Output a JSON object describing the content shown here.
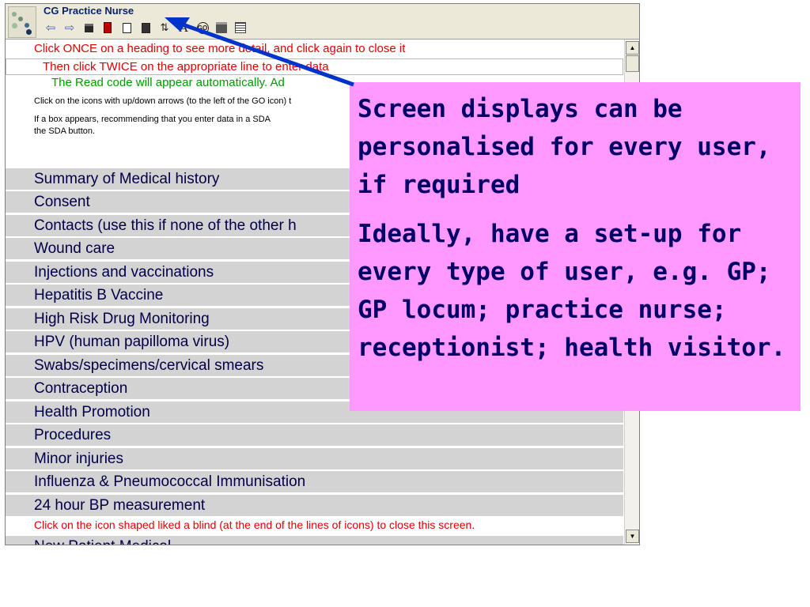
{
  "window": {
    "title": "CG Practice Nurse",
    "toolbar": [
      {
        "name": "back-arrow-icon",
        "glyph": "⇦"
      },
      {
        "name": "forward-arrow-icon",
        "glyph": "⇨"
      },
      {
        "name": "folder-icon",
        "glyph": ""
      },
      {
        "name": "book-icon",
        "glyph": ""
      },
      {
        "name": "document-icon",
        "glyph": ""
      },
      {
        "name": "notes-icon",
        "glyph": ""
      },
      {
        "name": "up-down-arrows-icon",
        "glyph": "⇅"
      },
      {
        "name": "font-icon",
        "glyph": "A"
      },
      {
        "name": "go-icon",
        "glyph": "GO"
      },
      {
        "name": "printer-icon",
        "glyph": ""
      },
      {
        "name": "blind-icon",
        "glyph": ""
      }
    ]
  },
  "instructions": {
    "line1": "Click ONCE on a heading to see more detail, and click again to close it",
    "line2": "Then click TWICE on the appropriate line to enter data",
    "line3": "The Read code will appear automatically. Ad",
    "line4": "Click on the icons with up/down arrows (to the left of the GO icon) t",
    "line5": "If a box appears, recommending that you enter data in a SDA",
    "line6": "the SDA button."
  },
  "headings": [
    "Summary of Medical history",
    "Consent",
    "Contacts (use this if none of the other h",
    "Wound care",
    "Injections and vaccinations",
    "Hepatitis B Vaccine",
    "High Risk Drug Monitoring",
    "HPV (human papilloma virus)",
    "Swabs/specimens/cervical smears",
    "Contraception",
    "Health Promotion",
    "Procedures",
    "Minor injuries",
    "Influenza & Pneumococcal Immunisation",
    "24 hour BP measurement"
  ],
  "footer_note": "Click on the icon shaped liked a blind (at the end of the lines of icons) to close this screen.",
  "partial_row": "New Patient Medical",
  "callout": {
    "paragraph1": "Screen displays can be personalised for every user, if required",
    "paragraph2": "Ideally, have a set-up for every type of user, e.g. GP; GP locum; practice nurse; receptionist; health visitor."
  },
  "colors": {
    "instruction_red": "#e00000",
    "instruction_green": "#009a00",
    "heading_bg": "#d3d3d3",
    "callout_bg": "#ff99ff",
    "arrow": "#0033cc"
  }
}
